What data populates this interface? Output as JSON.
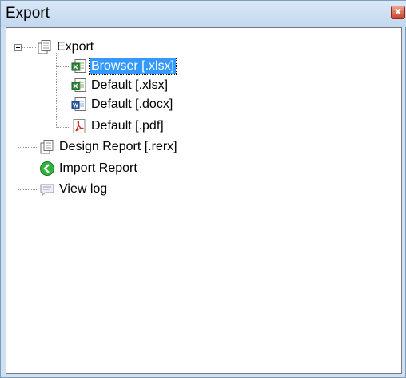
{
  "window": {
    "title": "Export",
    "close_glyph": "x"
  },
  "tree": {
    "root": {
      "label": "Export",
      "icon": "document-stack-icon",
      "expanded": true
    },
    "children": [
      {
        "label": "Browser [.xlsx]",
        "icon": "excel-icon",
        "selected": true
      },
      {
        "label": "Default [.xlsx]",
        "icon": "excel-icon",
        "selected": false
      },
      {
        "label": "Default [.docx]",
        "icon": "word-icon",
        "selected": false
      },
      {
        "label": "Default [.pdf]",
        "icon": "pdf-icon",
        "selected": false
      }
    ],
    "siblings": [
      {
        "label": "Design Report [.rerx]",
        "icon": "document-stack-icon"
      },
      {
        "label": "Import Report",
        "icon": "green-arrow-icon"
      },
      {
        "label": "View log",
        "icon": "speech-bubble-icon"
      }
    ]
  },
  "colors": {
    "selection": "#3399ff",
    "titlebar": "#cfe0f3",
    "close": "#c9442b"
  }
}
